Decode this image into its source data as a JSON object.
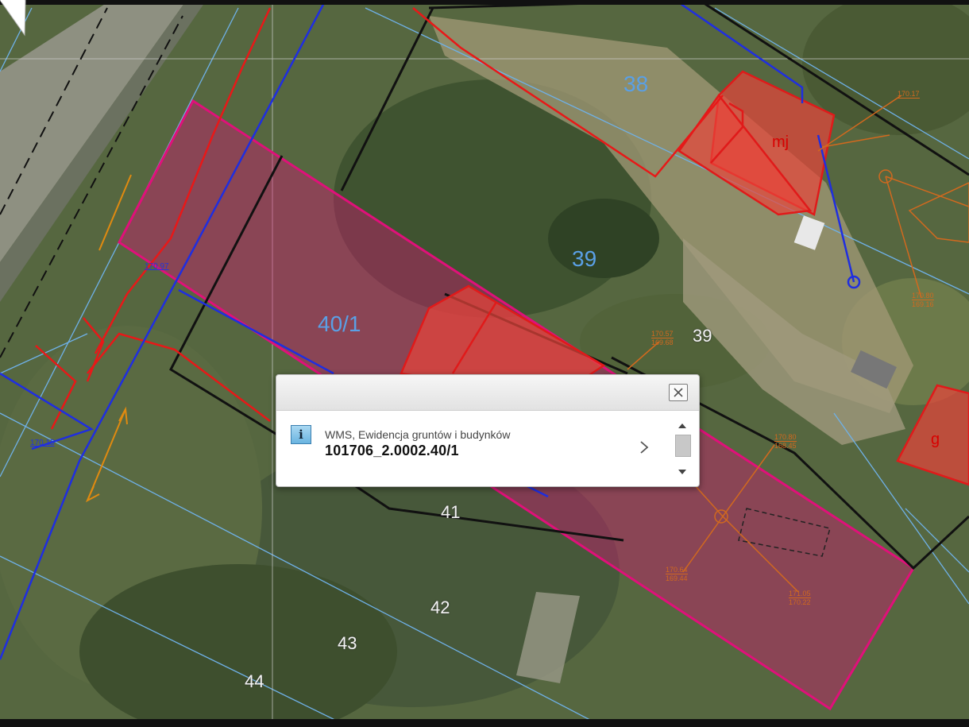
{
  "map": {
    "parcels_blue": [
      "38",
      "39",
      "40/1"
    ],
    "parcels_white": [
      "39",
      "41",
      "42",
      "43",
      "44"
    ],
    "buildings": [
      "mj",
      "g"
    ],
    "elevation_labels": [
      {
        "top": "170.57",
        "bottom": "169.68"
      },
      {
        "top": "170.80",
        "bottom": "168.45"
      },
      {
        "top": "170.64",
        "bottom": "169.44"
      },
      {
        "top": "171.05",
        "bottom": "170.22"
      },
      {
        "top": "170.80",
        "bottom": "169.16"
      },
      {
        "top": "170.17",
        "bottom": ""
      }
    ],
    "utility_labels": [
      "170.15",
      "170.97"
    ],
    "colors": {
      "parcel_highlight": "#e0107a",
      "parcel_boundary": "#111111",
      "building": "#e01a1a",
      "water_line": "#1f2ee0",
      "gas_line": "#e81818",
      "parcel_lines": "#6fb1e8",
      "elevation": "#d2691e"
    }
  },
  "popup": {
    "layer_name": "WMS, Ewidencja gruntów i budynków",
    "feature_id": "101706_2.0002.40/1",
    "icons": {
      "info": "info-icon",
      "close": "close-icon",
      "next": "chevron-right-icon",
      "scroll_up": "arrow-up-icon",
      "scroll_down": "arrow-down-icon"
    },
    "info_glyph": "i"
  }
}
